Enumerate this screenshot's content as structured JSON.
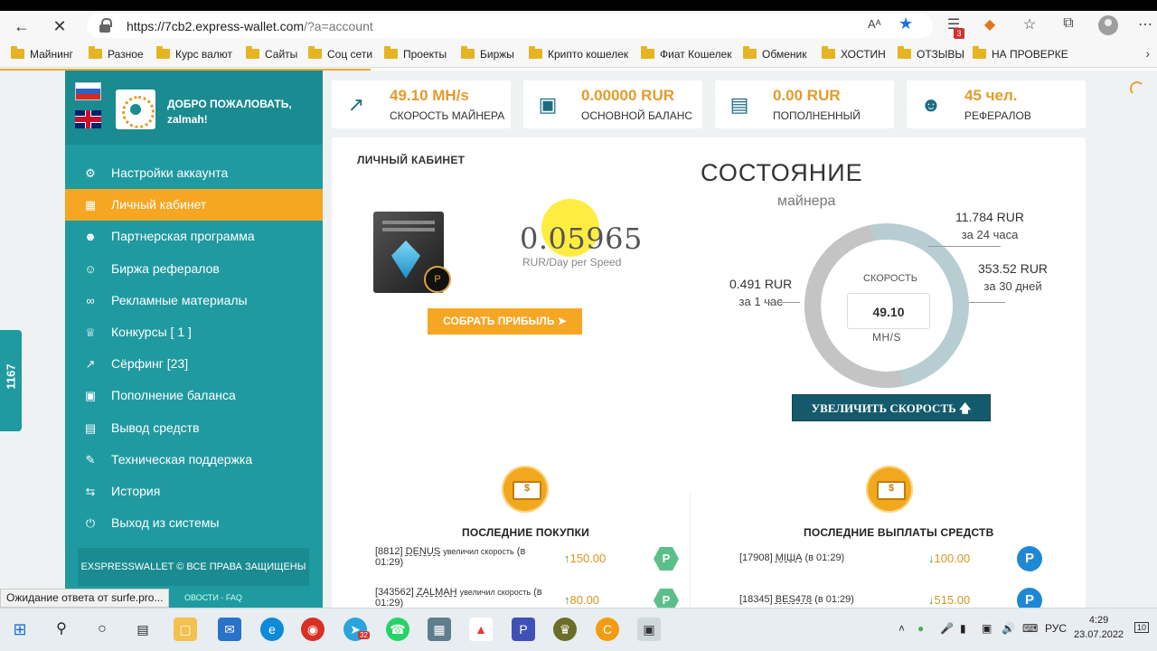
{
  "browser": {
    "url_main": "https://7cb2.express-wallet.com",
    "url_query": "/?a=account",
    "reader_label": "Aᴬ",
    "bookmarks": [
      "Майнинг",
      "Разное",
      "Курс валют",
      "Сайты",
      "Соц сети",
      "Проекты",
      "Биржы",
      "Крипто кошелек",
      "Фиат Кошелек",
      "Обменик",
      "ХОСТИН",
      "ОТЗЫВЫ",
      "НА ПРОВЕРКЕ"
    ],
    "badge_count": "3",
    "status_text": "Ожидание ответа от surfe.pro..."
  },
  "sidebar": {
    "welcome_line1": "ДОБРО ПОЖАЛОВАТЬ,",
    "welcome_line2": "zalmah!",
    "menu": [
      {
        "label": "Настройки аккаунта",
        "icon": "gears-icon"
      },
      {
        "label": "Личный кабинет",
        "icon": "bar-chart-icon"
      },
      {
        "label": "Партнерская программа",
        "icon": "users-icon"
      },
      {
        "label": "Биржа рефералов",
        "icon": "user-plus-icon"
      },
      {
        "label": "Рекламные материалы",
        "icon": "link-icon"
      },
      {
        "label": "Конкурсы [ 1 ]",
        "icon": "trophy-icon"
      },
      {
        "label": "Сёрфинг [23]",
        "icon": "external-link-icon"
      },
      {
        "label": "Пополнение баланса",
        "icon": "briefcase-icon"
      },
      {
        "label": "Вывод средств",
        "icon": "credit-card-icon"
      },
      {
        "label": "Техническая поддержка",
        "icon": "chat-icon"
      },
      {
        "label": "История",
        "icon": "exchange-icon"
      },
      {
        "label": "Выход из системы",
        "icon": "power-icon"
      }
    ],
    "copyright": "EXSPRESSWALLET © ВСЕ ПРАВА ЗАЩИЩЕНЫ",
    "footer_links": "ОВОСТИ  -  FAQ",
    "side_tab_count": "1167"
  },
  "stats": [
    {
      "value": "49.10 MH/s",
      "label": "СКОРОСТЬ МАЙНЕРА",
      "icon": "line-chart-icon"
    },
    {
      "value": "0.00000 RUR",
      "label": "ОСНОВНОЙ БАЛАНС",
      "icon": "briefcase-icon"
    },
    {
      "value": "0.00 RUR",
      "label": "ПОПОЛНЕННЫЙ",
      "icon": "credit-card-icon"
    },
    {
      "value": "45 чел.",
      "label": "РЕФЕРАЛОВ",
      "icon": "users-icon"
    }
  ],
  "cabinet": {
    "title": "ЛИЧНЫЙ КАБИНЕТ",
    "profit": "0.05965",
    "profit_unit": "RUR/Day per Speed",
    "collect_label": "СОБРАТЬ ПРИБЫЛЬ"
  },
  "miner_state": {
    "title": "СОСТОЯНИЕ",
    "subtitle": "майнера",
    "speed_label": "СКОРОСТЬ",
    "speed_value": "49.10",
    "speed_unit": "MH/S",
    "hour_value": "0.491 RUR",
    "hour_label": "за 1 час",
    "day_value": "11.784 RUR",
    "day_label": "за 24 часа",
    "month_value": "353.52 RUR",
    "month_label": "за 30 дней",
    "gauge_fill_fraction": 0.5,
    "boost_label": "УВЕЛИЧИТЬ СКОРОСТЬ"
  },
  "purchases": {
    "title": "ПОСЛЕДНИЕ ПОКУПКИ",
    "rows": [
      {
        "id": "[8812]",
        "user": "DENUS",
        "action": "увеличил скорость",
        "time": "(в 01:29)",
        "amount": "150.00"
      },
      {
        "id": "[343562]",
        "user": "ZALMAH",
        "action": "увеличил скорость",
        "time": "(в 01:29)",
        "amount": "80.00"
      }
    ]
  },
  "payouts": {
    "title": "ПОСЛЕДНИЕ ВЫПЛАТЫ СРЕДСТВ",
    "rows": [
      {
        "id": "[17908]",
        "user": "МIША",
        "time": "(в 01:29)",
        "amount": "100.00"
      },
      {
        "id": "[18345]",
        "user": "BES478",
        "time": "(в 01:29)",
        "amount": "515.00"
      }
    ]
  },
  "taskbar": {
    "lang": "РУС",
    "time": "4:29",
    "date": "23.07.2022",
    "telegram_badge": "32",
    "notif_count": "10"
  }
}
